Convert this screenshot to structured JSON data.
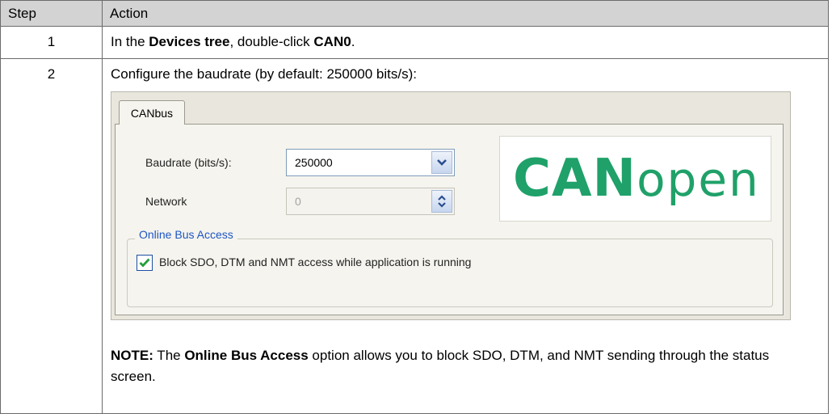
{
  "table": {
    "header_step": "Step",
    "header_action": "Action",
    "rows": [
      {
        "step": "1",
        "text_before": "In the ",
        "bold_1": "Devices tree",
        "text_middle": ", double-click ",
        "bold_2": "CAN0",
        "text_after": "."
      },
      {
        "step": "2",
        "instruction": "Configure the baudrate (by default: 250000 bits/s):"
      }
    ]
  },
  "dialog": {
    "tab_label": "CANbus",
    "baudrate_label": "Baudrate (bits/s):",
    "baudrate_value": "250000",
    "network_label": "Network",
    "network_value": "0",
    "logo_text_bold": "CAN",
    "logo_text_thin": "open",
    "group_title": "Online Bus Access",
    "checkbox_checked": true,
    "checkbox_label": "Block SDO, DTM and NMT access while application is running",
    "logo_color": "#1fa169",
    "group_title_color": "#1d56c4"
  },
  "note": {
    "prefix": "NOTE:",
    "text_1": " The ",
    "bold": "Online Bus Access",
    "text_2": " option allows you to block SDO, DTM, and NMT sending through the status screen."
  }
}
